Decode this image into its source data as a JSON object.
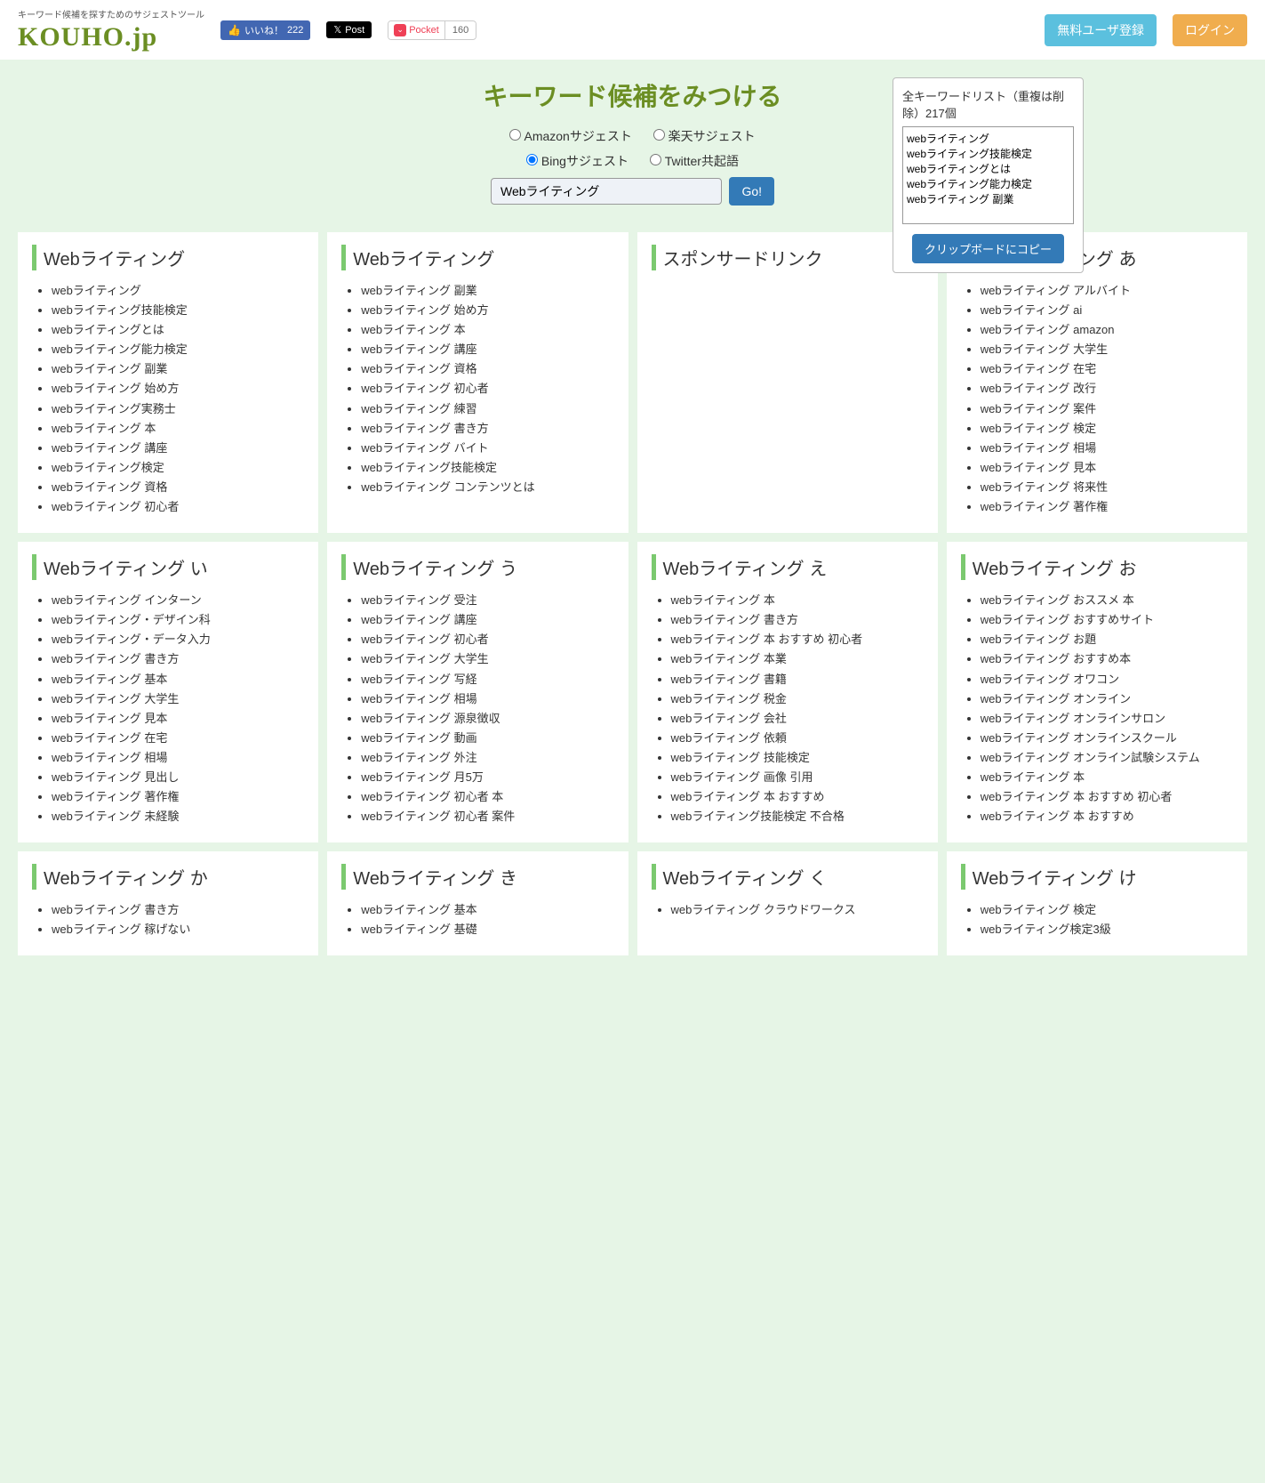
{
  "header": {
    "logo_tag": "キーワード候補を探すためのサジェストツール",
    "logo": "KOUHO.jp",
    "fb_label": "いいね！",
    "fb_count": "222",
    "x_label": "Post",
    "pocket_label": "Pocket",
    "pocket_count": "160",
    "register": "無料ユーザ登録",
    "login": "ログイン"
  },
  "search": {
    "title": "キーワード候補をみつける",
    "radios": {
      "amazon": "Amazonサジェスト",
      "rakuten": "楽天サジェスト",
      "bing": "Bingサジェスト",
      "twitter": "Twitter共起語"
    },
    "input_value": "Webライティング",
    "go": "Go!"
  },
  "sidebar": {
    "title": "全キーワードリスト（重複は削除）217個",
    "textarea": "webライティング\nwebライティング技能検定\nwebライティングとは\nwebライティング能力検定\nwebライティング 副業",
    "copy": "クリップボードにコピー"
  },
  "cards": [
    {
      "title": "Webライティング",
      "items": [
        "webライティング",
        "webライティング技能検定",
        "webライティングとは",
        "webライティング能力検定",
        "webライティング 副業",
        "webライティング 始め方",
        "webライティング実務士",
        "webライティング 本",
        "webライティング 講座",
        "webライティング検定",
        "webライティング 資格",
        "webライティング 初心者"
      ]
    },
    {
      "title": "Webライティング",
      "items": [
        "webライティング 副業",
        "webライティング 始め方",
        "webライティング 本",
        "webライティング 講座",
        "webライティング 資格",
        "webライティング 初心者",
        "webライティング 練習",
        "webライティング 書き方",
        "webライティング バイト",
        "webライティング技能検定",
        "webライティング コンテンツとは"
      ]
    },
    {
      "title": "スポンサードリンク",
      "items": []
    },
    {
      "title": "Webライティング あ",
      "items": [
        "webライティング アルバイト",
        "webライティング ai",
        "webライティング amazon",
        "webライティング 大学生",
        "webライティング 在宅",
        "webライティング 改行",
        "webライティング 案件",
        "webライティング 検定",
        "webライティング 相場",
        "webライティング 見本",
        "webライティング 将来性",
        "webライティング 著作権"
      ]
    },
    {
      "title": "Webライティング い",
      "items": [
        "webライティング インターン",
        "webライティング・デザイン科",
        "webライティング・データ入力",
        "webライティング 書き方",
        "webライティング 基本",
        "webライティング 大学生",
        "webライティング 見本",
        "webライティング 在宅",
        "webライティング 相場",
        "webライティング 見出し",
        "webライティング 著作権",
        "webライティング 未経験"
      ]
    },
    {
      "title": "Webライティング う",
      "items": [
        "webライティング 受注",
        "webライティング 講座",
        "webライティング 初心者",
        "webライティング 大学生",
        "webライティング 写経",
        "webライティング 相場",
        "webライティング 源泉徴収",
        "webライティング 動画",
        "webライティング 外注",
        "webライティング 月5万",
        "webライティング 初心者 本",
        "webライティング 初心者 案件"
      ]
    },
    {
      "title": "Webライティング え",
      "items": [
        "webライティング 本",
        "webライティング 書き方",
        "webライティング 本 おすすめ 初心者",
        "webライティング 本業",
        "webライティング 書籍",
        "webライティング 税金",
        "webライティング 会社",
        "webライティング 依頼",
        "webライティング 技能検定",
        "webライティング 画像 引用",
        "webライティング 本 おすすめ",
        "webライティング技能検定 不合格"
      ]
    },
    {
      "title": "Webライティング お",
      "items": [
        "webライティング おススメ 本",
        "webライティング おすすめサイト",
        "webライティング お題",
        "webライティング おすすめ本",
        "webライティング オワコン",
        "webライティング オンライン",
        "webライティング オンラインサロン",
        "webライティング オンラインスクール",
        "webライティング オンライン試験システム",
        "webライティング 本",
        "webライティング 本 おすすめ 初心者",
        "webライティング 本 おすすめ"
      ]
    },
    {
      "title": "Webライティング か",
      "items": [
        "webライティング 書き方",
        "webライティング 稼げない"
      ]
    },
    {
      "title": "Webライティング き",
      "items": [
        "webライティング 基本",
        "webライティング 基礎"
      ]
    },
    {
      "title": "Webライティング く",
      "items": [
        "webライティング クラウドワークス"
      ]
    },
    {
      "title": "Webライティング け",
      "items": [
        "webライティング 検定",
        "webライティング検定3級"
      ]
    }
  ]
}
